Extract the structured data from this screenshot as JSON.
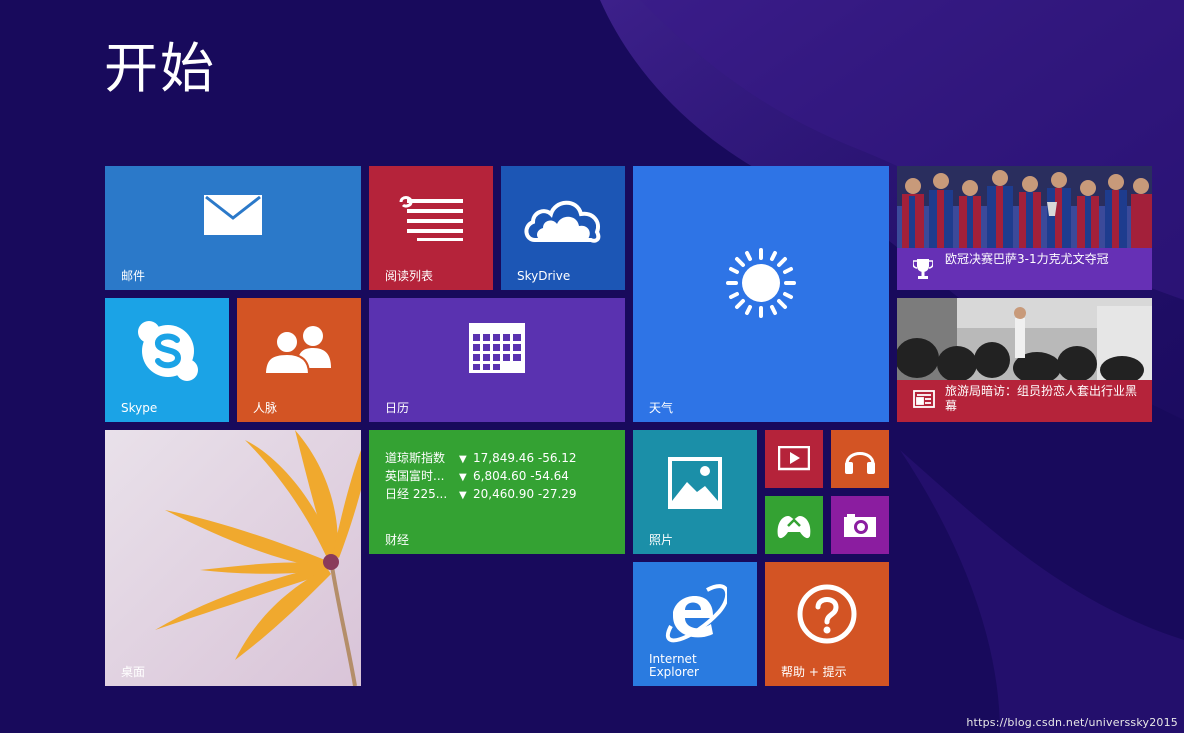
{
  "screen": {
    "title": "开始"
  },
  "tiles": {
    "mail": {
      "label": "邮件",
      "color": "#2b79c9",
      "icon": "envelope-icon"
    },
    "reading_list": {
      "label": "阅读列表",
      "color": "#b5233a",
      "icon": "reading-list-icon"
    },
    "skydrive": {
      "label": "SkyDrive",
      "color": "#1c56b5",
      "icon": "cloud-icon"
    },
    "weather": {
      "label": "天气",
      "color": "#2e74e6",
      "icon": "sun-icon"
    },
    "skype": {
      "label": "Skype",
      "color": "#1ba3e6",
      "icon": "skype-icon"
    },
    "people": {
      "label": "人脉",
      "color": "#d35424",
      "icon": "people-icon"
    },
    "calendar": {
      "label": "日历",
      "color": "#5a32b0",
      "icon": "calendar-icon"
    },
    "desktop": {
      "label": "桌面",
      "icon": "flower-wallpaper"
    },
    "finance": {
      "label": "财经",
      "color": "#34a233",
      "rows": [
        {
          "name": "道琼斯指数",
          "arrow": "▼",
          "value": "17,849.46 -56.12"
        },
        {
          "name": "英国富时...",
          "arrow": "▼",
          "value": "6,804.60 -54.64"
        },
        {
          "name": "日经 225...",
          "arrow": "▼",
          "value": "20,460.90 -27.29"
        }
      ]
    },
    "photos": {
      "label": "照片",
      "color": "#1b8fa8",
      "icon": "photo-icon"
    },
    "video": {
      "color": "#b5233a",
      "icon": "video-icon"
    },
    "music": {
      "color": "#d35424",
      "icon": "headphones-icon"
    },
    "games": {
      "color": "#34a233",
      "icon": "gamepad-icon"
    },
    "camera": {
      "color": "#8b1da0",
      "icon": "camera-icon"
    },
    "ie": {
      "label_line1": "Internet",
      "label_line2": "Explorer",
      "color": "#2a7be0",
      "icon": "ie-icon"
    },
    "help": {
      "label": "帮助 + 提示",
      "color": "#d35424",
      "icon": "question-icon"
    }
  },
  "news": [
    {
      "headline": "欧冠决赛巴萨3-1力克尤文夺冠",
      "icon": "trophy-icon",
      "bar_color": "#6630b5"
    },
    {
      "headline": "旅游局暗访：组员扮恋人套出行业黑幕",
      "icon": "news-icon",
      "bar_color": "#b5233a"
    }
  ],
  "watermark": "https://blog.csdn.net/universsky2015"
}
